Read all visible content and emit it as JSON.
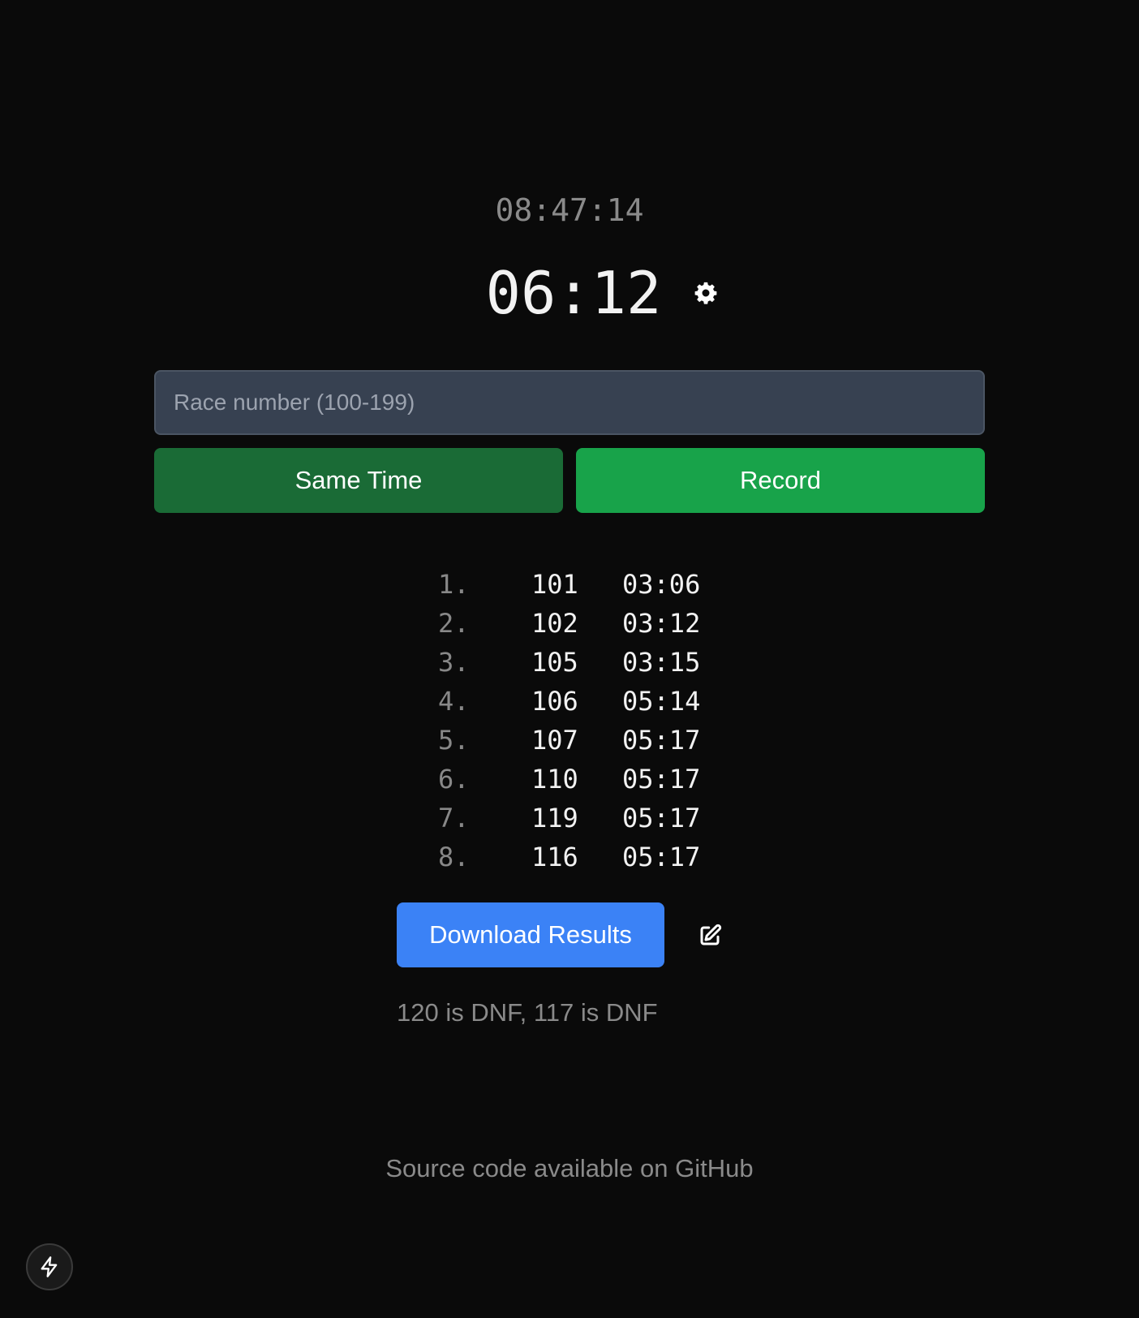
{
  "clock": "08:47:14",
  "timer": "06:12",
  "icons": {
    "settings": "gear-icon",
    "edit": "edit-icon",
    "dev": "lightning-icon"
  },
  "input": {
    "placeholder": "Race number (100-199)",
    "value": ""
  },
  "buttons": {
    "same_time": "Same Time",
    "record": "Record",
    "download": "Download Results"
  },
  "results": [
    {
      "pos": "1.",
      "number": "101",
      "time": "03:06"
    },
    {
      "pos": "2.",
      "number": "102",
      "time": "03:12"
    },
    {
      "pos": "3.",
      "number": "105",
      "time": "03:15"
    },
    {
      "pos": "4.",
      "number": "106",
      "time": "05:14"
    },
    {
      "pos": "5.",
      "number": "107",
      "time": "05:17"
    },
    {
      "pos": "6.",
      "number": "110",
      "time": "05:17"
    },
    {
      "pos": "7.",
      "number": "119",
      "time": "05:17"
    },
    {
      "pos": "8.",
      "number": "116",
      "time": "05:17"
    }
  ],
  "dnf_text": "120 is DNF, 117 is DNF",
  "footer": "Source code available on GitHub",
  "colors": {
    "background": "#0a0a0a",
    "same_time_button": "#1a6b36",
    "record_button": "#18a34a",
    "download_button": "#3b82f6",
    "input_background": "#374151"
  }
}
